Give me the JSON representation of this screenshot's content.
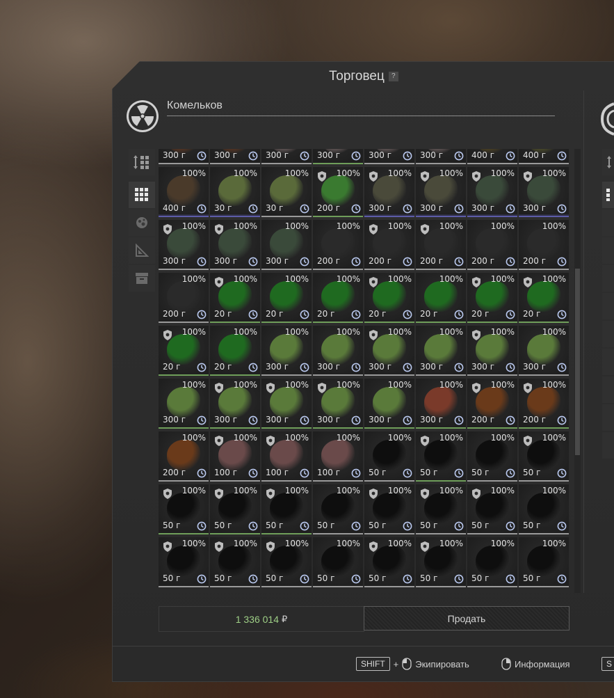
{
  "window": {
    "title": "Торговец",
    "help_glyph": "?"
  },
  "trader": {
    "name": "Комельков"
  },
  "left_tabs": [
    {
      "icon": "sort-icon"
    },
    {
      "icon": "grid-icon",
      "active": true
    },
    {
      "icon": "artifact-icon"
    },
    {
      "icon": "blueprint-icon"
    },
    {
      "icon": "box-icon"
    }
  ],
  "items": [
    {
      "price": "300 г",
      "color": "#6a3a20",
      "border": "grey"
    },
    {
      "price": "300 г",
      "color": "#6a3a20",
      "border": "grey"
    },
    {
      "price": "300 г",
      "color": "#7a6a6a",
      "border": "grey"
    },
    {
      "price": "300 г",
      "color": "#7a6a6a",
      "border": "green"
    },
    {
      "price": "300 г",
      "color": "#7a6a6a",
      "border": "grey"
    },
    {
      "price": "300 г",
      "color": "#7a6a6a",
      "border": "grey"
    },
    {
      "price": "400 г",
      "color": "#5a4a20",
      "border": "grey"
    },
    {
      "price": "400 г",
      "color": "#5a5a2a",
      "border": "grey"
    },
    {
      "pct": "100%",
      "price": "400 г",
      "color": "#4a3a2a",
      "border": "blue"
    },
    {
      "pct": "100%",
      "price": "30 г",
      "color": "#5a6a3a",
      "border": "blue"
    },
    {
      "pct": "100%",
      "price": "30 г",
      "color": "#5a6a3a",
      "border": "grey"
    },
    {
      "pct": "100%",
      "price": "200 г",
      "color": "#3a7a30",
      "border": "green",
      "shield": true
    },
    {
      "pct": "100%",
      "price": "300 г",
      "color": "#4a4a3a",
      "border": "blue",
      "shield": true
    },
    {
      "pct": "100%",
      "price": "300 г",
      "color": "#4a4a3a",
      "border": "blue",
      "shield": true
    },
    {
      "pct": "100%",
      "price": "300 г",
      "color": "#3a4a3a",
      "border": "blue",
      "shield": true
    },
    {
      "pct": "100%",
      "price": "300 г",
      "color": "#3a4a3a",
      "border": "blue",
      "shield": true
    },
    {
      "pct": "100%",
      "price": "300 г",
      "color": "#3a4a3a",
      "border": "grey",
      "shield": true
    },
    {
      "pct": "100%",
      "price": "300 г",
      "color": "#3a4a3a",
      "border": "grey",
      "shield": true
    },
    {
      "pct": "100%",
      "price": "300 г",
      "color": "#3a4a3a",
      "border": "grey"
    },
    {
      "pct": "100%",
      "price": "200 г",
      "color": "#2a2a2a",
      "border": "grey"
    },
    {
      "pct": "100%",
      "price": "200 г",
      "color": "#2a2a2a",
      "border": "grey",
      "shield": true
    },
    {
      "pct": "100%",
      "price": "200 г",
      "color": "#2a2a2a",
      "border": "grey",
      "shield": true
    },
    {
      "pct": "100%",
      "price": "200 г",
      "color": "#2a2a2a",
      "border": "grey"
    },
    {
      "pct": "100%",
      "price": "200 г",
      "color": "#2a2a2a",
      "border": "grey"
    },
    {
      "pct": "100%",
      "price": "200 г",
      "color": "#2a2a2a",
      "border": "grey"
    },
    {
      "pct": "100%",
      "price": "20 г",
      "color": "#1f6a20",
      "border": "green",
      "shield": true
    },
    {
      "pct": "100%",
      "price": "20 г",
      "color": "#1f6a20",
      "border": "green"
    },
    {
      "pct": "100%",
      "price": "20 г",
      "color": "#1f6a20",
      "border": "green"
    },
    {
      "pct": "100%",
      "price": "20 г",
      "color": "#1f6a20",
      "border": "green",
      "shield": true
    },
    {
      "pct": "100%",
      "price": "20 г",
      "color": "#1f6a20",
      "border": "green"
    },
    {
      "pct": "100%",
      "price": "20 г",
      "color": "#1f6a20",
      "border": "green",
      "shield": true
    },
    {
      "pct": "100%",
      "price": "20 г",
      "color": "#1f6a20",
      "border": "green",
      "shield": true
    },
    {
      "pct": "100%",
      "price": "20 г",
      "color": "#1f6a20",
      "border": "green",
      "shield": true
    },
    {
      "pct": "100%",
      "price": "20 г",
      "color": "#1f6a20",
      "border": "green"
    },
    {
      "pct": "100%",
      "price": "300 г",
      "color": "#5a7a3a",
      "border": "grey"
    },
    {
      "pct": "100%",
      "price": "300 г",
      "color": "#5a7a3a",
      "border": "grey"
    },
    {
      "pct": "100%",
      "price": "300 г",
      "color": "#5a7a3a",
      "border": "grey",
      "shield": true
    },
    {
      "pct": "100%",
      "price": "300 г",
      "color": "#5a7a3a",
      "border": "grey"
    },
    {
      "pct": "100%",
      "price": "300 г",
      "color": "#5a7a3a",
      "border": "grey",
      "shield": true
    },
    {
      "pct": "100%",
      "price": "300 г",
      "color": "#5a7a3a",
      "border": "grey"
    },
    {
      "pct": "100%",
      "price": "300 г",
      "color": "#5a7a3a",
      "border": "green"
    },
    {
      "pct": "100%",
      "price": "300 г",
      "color": "#5a7a3a",
      "border": "green",
      "shield": true
    },
    {
      "pct": "100%",
      "price": "300 г",
      "color": "#5a7a3a",
      "border": "green",
      "shield": true
    },
    {
      "pct": "100%",
      "price": "300 г",
      "color": "#5a7a3a",
      "border": "green",
      "shield": true
    },
    {
      "pct": "100%",
      "price": "300 г",
      "color": "#5a7a3a",
      "border": "green"
    },
    {
      "pct": "100%",
      "price": "300 г",
      "color": "#7a3a2a",
      "border": "green"
    },
    {
      "pct": "100%",
      "price": "200 г",
      "color": "#6a3a1a",
      "border": "green",
      "shield": true
    },
    {
      "pct": "100%",
      "price": "200 г",
      "color": "#6a3a1a",
      "border": "green",
      "shield": true
    },
    {
      "pct": "100%",
      "price": "200 г",
      "color": "#6a3a1a",
      "border": "grey"
    },
    {
      "pct": "100%",
      "price": "100 г",
      "color": "#6a4a4a",
      "border": "grey",
      "shield": true
    },
    {
      "pct": "100%",
      "price": "100 г",
      "color": "#6a4a4a",
      "border": "grey",
      "shield": true
    },
    {
      "pct": "100%",
      "price": "100 г",
      "color": "#6a4a4a",
      "border": "grey"
    },
    {
      "pct": "100%",
      "price": "50 г",
      "color": "#0e0e0e",
      "border": "grey"
    },
    {
      "pct": "100%",
      "price": "50 г",
      "color": "#0e0e0e",
      "border": "green",
      "shield": true
    },
    {
      "pct": "100%",
      "price": "50 г",
      "color": "#0e0e0e",
      "border": "grey"
    },
    {
      "pct": "100%",
      "price": "50 г",
      "color": "#0e0e0e",
      "border": "grey",
      "shield": true
    },
    {
      "pct": "100%",
      "price": "50 г",
      "color": "#0e0e0e",
      "border": "green",
      "shield": true
    },
    {
      "pct": "100%",
      "price": "50 г",
      "color": "#0e0e0e",
      "border": "green",
      "shield": true
    },
    {
      "pct": "100%",
      "price": "50 г",
      "color": "#0e0e0e",
      "border": "green",
      "shield": true
    },
    {
      "pct": "100%",
      "price": "50 г",
      "color": "#0e0e0e",
      "border": "grey"
    },
    {
      "pct": "100%",
      "price": "50 г",
      "color": "#0e0e0e",
      "border": "grey",
      "shield": true
    },
    {
      "pct": "100%",
      "price": "50 г",
      "color": "#0e0e0e",
      "border": "grey",
      "shield": true
    },
    {
      "pct": "100%",
      "price": "50 г",
      "color": "#0e0e0e",
      "border": "grey",
      "shield": true
    },
    {
      "pct": "100%",
      "price": "50 г",
      "color": "#0e0e0e",
      "border": "grey"
    },
    {
      "pct": "100%",
      "price": "50 г",
      "color": "#0e0e0e",
      "border": "grey",
      "shield": true
    },
    {
      "pct": "100%",
      "price": "50 г",
      "color": "#0e0e0e",
      "border": "grey",
      "shield": true
    },
    {
      "pct": "100%",
      "price": "50 г",
      "color": "#0e0e0e",
      "border": "grey",
      "shield": true
    },
    {
      "pct": "100%",
      "price": "50 г",
      "color": "#0e0e0e",
      "border": "grey"
    },
    {
      "pct": "100%",
      "price": "50 г",
      "color": "#0e0e0e",
      "border": "grey",
      "shield": true
    },
    {
      "pct": "100%",
      "price": "50 г",
      "color": "#0e0e0e",
      "border": "grey",
      "shield": true
    },
    {
      "pct": "100%",
      "price": "50 г",
      "color": "#0e0e0e",
      "border": "grey"
    },
    {
      "pct": "100%",
      "price": "50 г",
      "color": "#0e0e0e",
      "border": "grey"
    }
  ],
  "summary": {
    "amount": "1 336 014",
    "currency": "₽"
  },
  "actions": {
    "sell_label": "Продать"
  },
  "hints": {
    "shift_key": "SHIFT",
    "plus": "+",
    "equip_label": "Экипировать",
    "info_label": "Информация",
    "next_key": "S"
  },
  "colors": {
    "accent_green": "#9ecf86",
    "border_blue": "#5c5ba8",
    "border_green": "#6f9e5a"
  }
}
